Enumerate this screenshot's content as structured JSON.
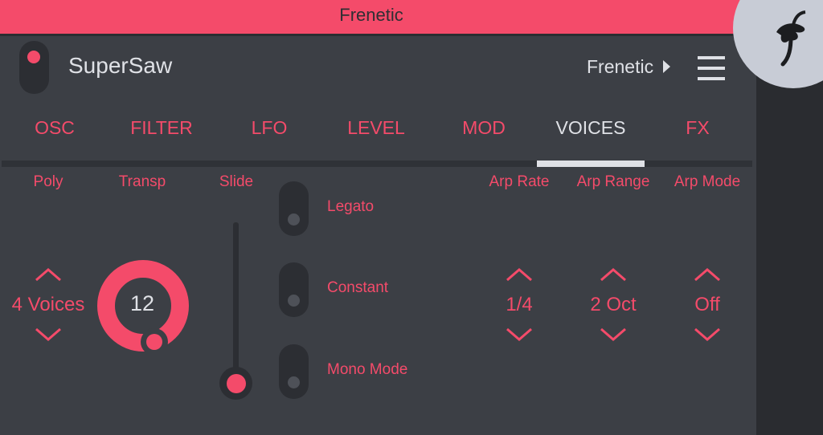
{
  "app": {
    "title": "Frenetic"
  },
  "header": {
    "preset_name": "SuperSaw",
    "bank_name": "Frenetic"
  },
  "tabs": [
    {
      "label": "OSC"
    },
    {
      "label": "FILTER"
    },
    {
      "label": "LFO"
    },
    {
      "label": "LEVEL"
    },
    {
      "label": "MOD"
    },
    {
      "label": "VOICES",
      "active": true
    },
    {
      "label": "FX"
    }
  ],
  "voices": {
    "poly": {
      "label": "Poly",
      "value": "4 Voices"
    },
    "transp": {
      "label": "Transp",
      "value": "12"
    },
    "slide": {
      "label": "Slide",
      "level": 0.0
    },
    "toggles": [
      {
        "label": "Legato",
        "on": false
      },
      {
        "label": "Constant",
        "on": false
      },
      {
        "label": "Mono Mode",
        "on": false
      }
    ],
    "arp_rate": {
      "label": "Arp Rate",
      "value": "1/4"
    },
    "arp_range": {
      "label": "Arp Range",
      "value": "2 Oct"
    },
    "arp_mode": {
      "label": "Arp Mode",
      "value": "Off"
    }
  },
  "colors": {
    "accent": "#f44b6a",
    "bg": "#3c3f45",
    "text": "#dfe1e6"
  },
  "icons": [
    "power-toggle-icon",
    "chevron-right-icon",
    "hamburger-menu-icon",
    "fruit-logo-icon",
    "chevron-up-icon",
    "chevron-down-icon"
  ]
}
